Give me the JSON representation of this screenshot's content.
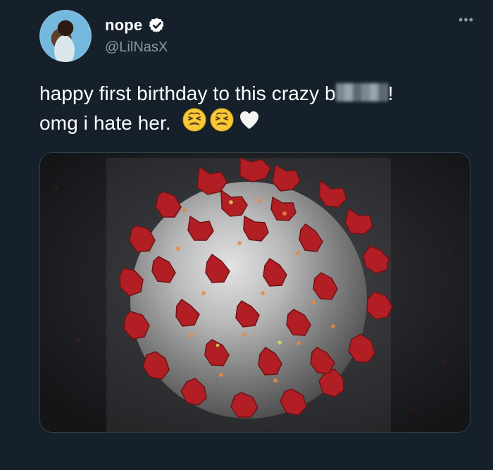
{
  "tweet": {
    "display_name": "nope",
    "handle": "@LilNasX",
    "text_before_redaction": "happy first birthday to this crazy b",
    "text_after_redaction": "!",
    "second_line": "omg i hate her.",
    "emoji_names": [
      "weary-face-icon",
      "weary-face-icon",
      "white-heart-icon"
    ]
  },
  "colors": {
    "background": "#15202b",
    "text": "#ffffff",
    "muted": "#8899a6",
    "virus_spike": "#b11f25"
  }
}
